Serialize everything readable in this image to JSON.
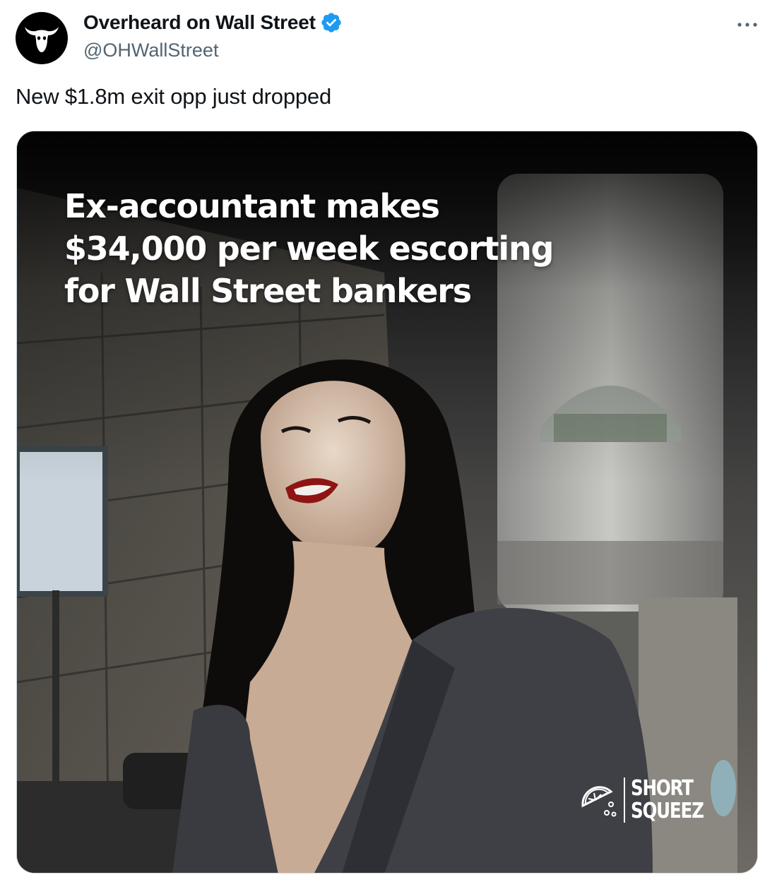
{
  "author": {
    "name": "Overheard on Wall Street",
    "handle": "@OHWallStreet",
    "verified": true,
    "avatar_icon": "bull-skull-icon"
  },
  "tweet": {
    "text": "New $1.8m exit opp just dropped"
  },
  "media": {
    "headline_lines": [
      "Ex-accountant makes",
      "$34,000 per week escorting",
      "for Wall Street bankers"
    ],
    "watermark_lines": [
      "SHORT",
      "SQUEEZ"
    ],
    "watermark_icon": "lemon-slice-icon"
  },
  "colors": {
    "verified_badge": "#1d9bf0",
    "handle_text": "#536471",
    "primary_text": "#0f1419"
  }
}
